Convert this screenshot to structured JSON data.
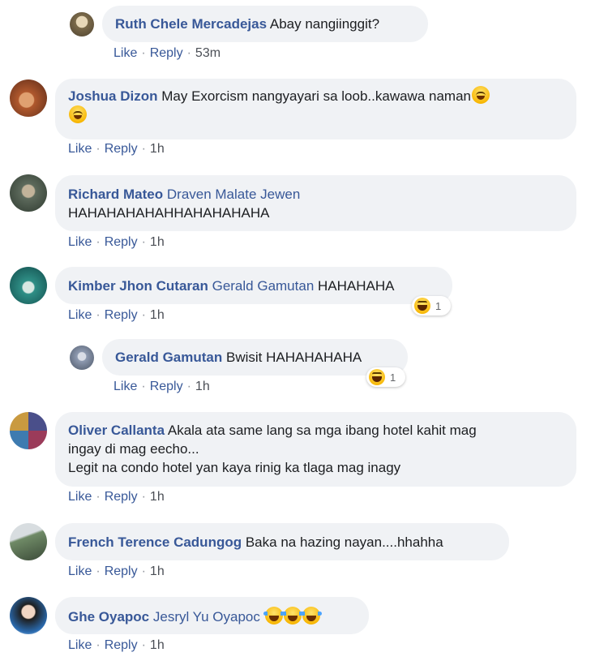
{
  "actions": {
    "like": "Like",
    "reply": "Reply",
    "sep": "·"
  },
  "comments": [
    {
      "author": "Ruth Chele Mercadejas",
      "mention": "",
      "text": "Abay nangiinggit?",
      "time": "53m",
      "avatar_color": "#7b6a4a"
    },
    {
      "author": "Joshua Dizon",
      "mention": "",
      "text": "May Exorcism nangyayari sa loob..kawawa naman",
      "emoji": "grinning-sweat-icon",
      "time": "1h",
      "avatar_color": "#b0582d"
    },
    {
      "author": "Richard Mateo",
      "mention": "Draven Malate Jewen",
      "text": "HAHAHAHAHAHHAHAHAHAHA",
      "time": "1h",
      "avatar_color": "#5d6a5c"
    },
    {
      "author": "Kimber Jhon Cutaran",
      "mention": "Gerald Gamutan",
      "text": "HAHAHAHA",
      "time": "1h",
      "reaction_count": "1",
      "avatar_color": "#2f8f86"
    },
    {
      "author": "Gerald Gamutan",
      "mention": "",
      "text": "Bwisit HAHAHAHAHA",
      "time": "1h",
      "reaction_count": "1",
      "avatar_color": "#8e9ab0"
    },
    {
      "author": "Oliver Callanta",
      "mention": "",
      "text_line1": "Akala ata same lang sa mga ibang hotel kahit mag",
      "text_line2": "ingay di mag eecho...",
      "text_line3": "Legit na condo hotel yan kaya rinig ka tlaga mag inagy",
      "time": "1h",
      "avatar_color": "#4a4f8a"
    },
    {
      "author": "French Terence Cadungog",
      "mention": "",
      "text": "Baka na hazing nayan....hhahha",
      "time": "1h",
      "avatar_color": "#6f8a66"
    },
    {
      "author": "Ghe Oyapoc",
      "mention": "Jesryl Yu Oyapoc",
      "text": "",
      "emoji": "joy-tears-icon",
      "time": "1h",
      "avatar_color": "#2a2a2a"
    }
  ]
}
